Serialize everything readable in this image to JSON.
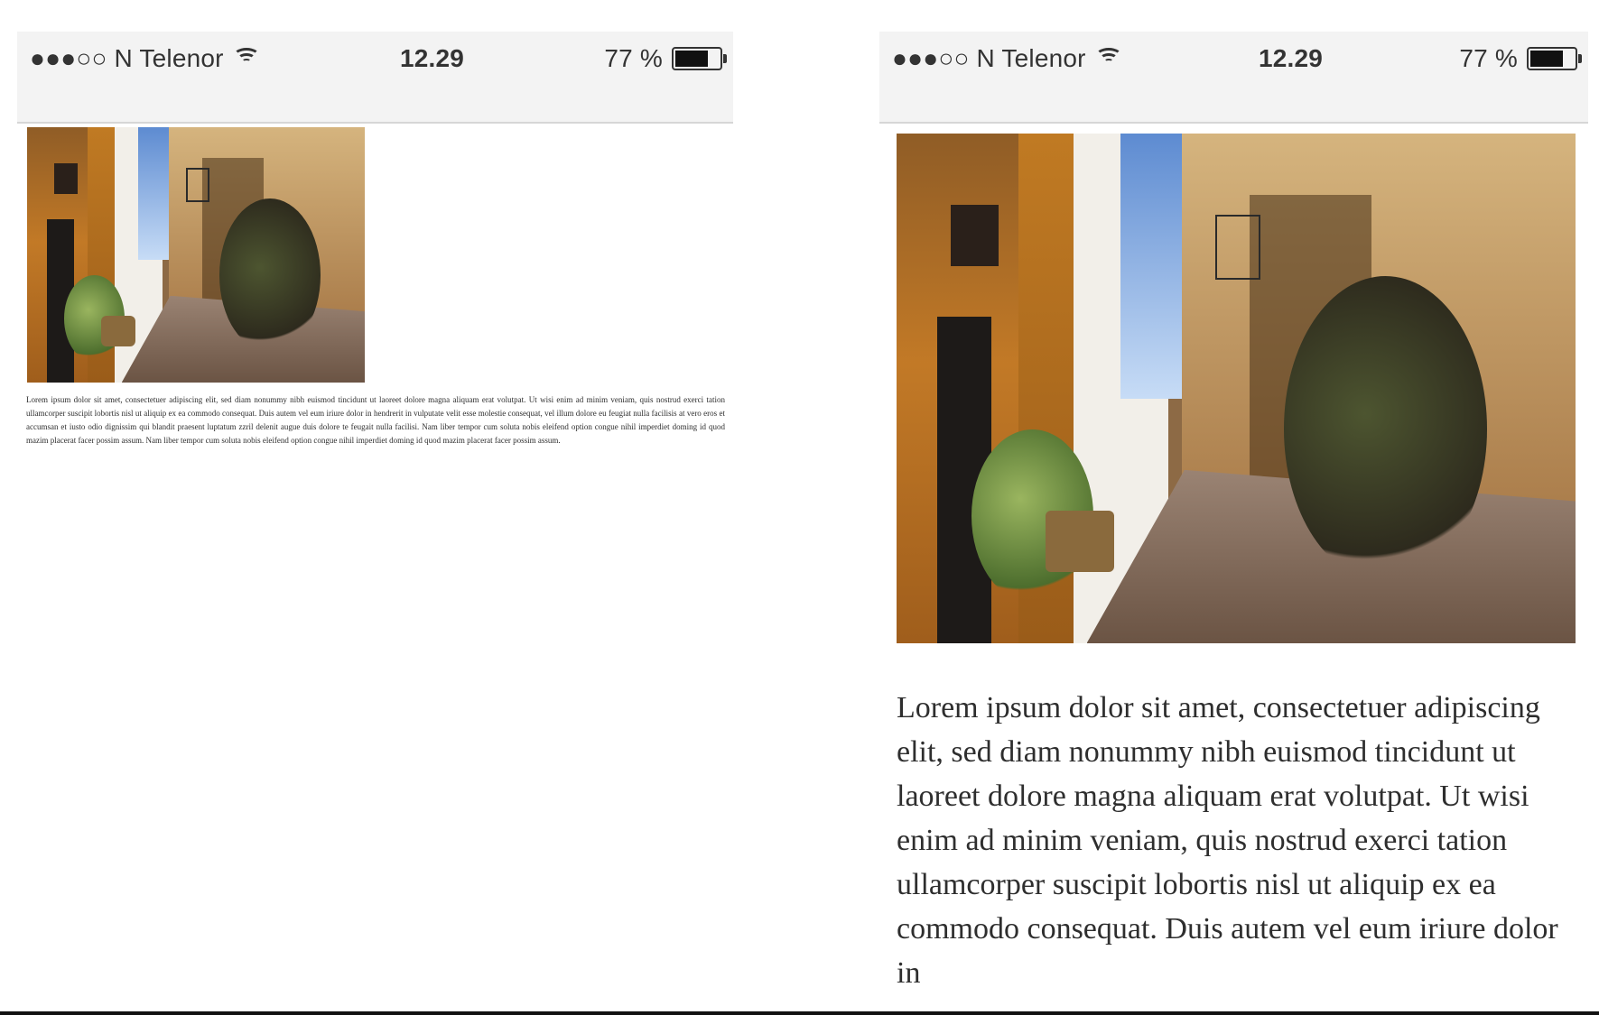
{
  "left_phone": {
    "status": {
      "carrier": "●●●○○ N Telenor",
      "time": "12.29",
      "battery": "77 %",
      "battery_level": 0.77
    },
    "image_label": "street-photo",
    "text": "Lorem ipsum dolor sit amet, consectetuer adipiscing elit, sed diam nonummy nibh euismod tincidunt ut laoreet dolore magna aliquam erat volutpat. Ut wisi enim ad minim veniam, quis nostrud exerci tation ullamcorper suscipit lobortis nisl ut aliquip ex ea commodo consequat. Duis autem vel eum iriure dolor in hendrerit in vulputate velit esse molestie consequat, vel illum dolore eu feugiat nulla facilisis at vero eros et accumsan et iusto odio dignissim qui blandit praesent luptatum zzril delenit augue duis dolore te feugait nulla facilisi. Nam liber tempor cum soluta nobis eleifend option congue nihil imperdiet doming id quod mazim placerat facer possim assum. Nam liber tempor cum soluta nobis eleifend option congue nihil imperdiet doming id quod mazim placerat facer possim assum."
  },
  "right_phone": {
    "status": {
      "carrier": "●●●○○ N Telenor",
      "time": "12.29",
      "battery": "77 %",
      "battery_level": 0.77
    },
    "image_label": "street-photo",
    "text": "Lorem ipsum dolor sit amet, consectetuer adipiscing elit, sed diam nonummy nibh euismod tincidunt ut laoreet dolore magna aliquam erat volutpat. Ut wisi enim ad minim veniam, quis nostrud exerci tation ullamcorper suscipit lobortis nisl ut aliquip ex ea commodo consequat. Duis autem vel eum iriure dolor in"
  }
}
